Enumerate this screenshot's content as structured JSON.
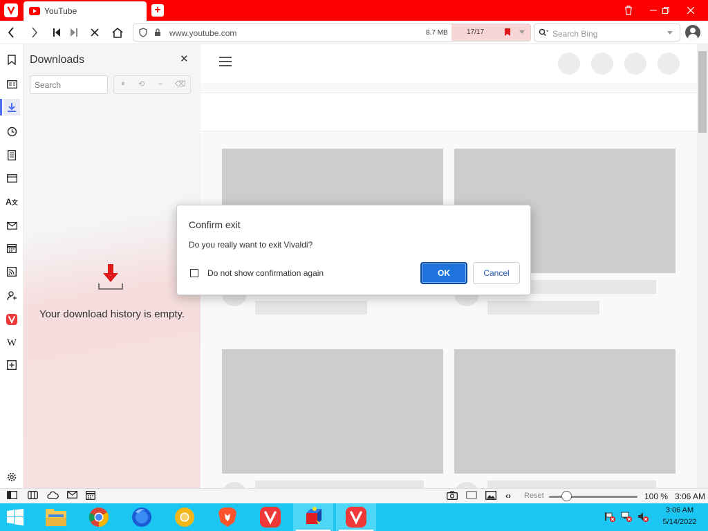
{
  "browser": {
    "tab": {
      "title": "YouTube"
    },
    "address": {
      "url": "www.youtube.com",
      "page_size": "8.7 MB",
      "blocker_count": "17/17"
    },
    "search": {
      "placeholder": "Search Bing"
    }
  },
  "downloads_panel": {
    "title": "Downloads",
    "search_placeholder": "Search",
    "empty_message": "Your download history is empty."
  },
  "dialog": {
    "title": "Confirm exit",
    "message": "Do you really want to exit Vivaldi?",
    "checkbox_label": "Do not show confirmation again",
    "checkbox_checked": false,
    "ok_label": "OK",
    "cancel_label": "Cancel"
  },
  "statusbar": {
    "reset_label": "Reset",
    "zoom": "100 %",
    "zoom_level": 0.2,
    "clock": "3:06 AM"
  },
  "taskbar": {
    "time": "3:06 AM",
    "date": "5/14/2022"
  },
  "colors": {
    "brand": "#fe0000",
    "taskbar": "#1bc7f2",
    "ok_button": "#1e73dd",
    "accent": "#4a6cf7"
  },
  "icons": {
    "side_panel": [
      "bookmark-icon",
      "reading-list-icon",
      "download-icon",
      "history-icon",
      "notes-icon",
      "window-icon",
      "translate-icon",
      "mail-icon",
      "calendar-icon",
      "feed-icon",
      "contacts-icon",
      "vivaldi-icon",
      "wikipedia-icon",
      "add-panel-icon",
      "settings-icon"
    ],
    "taskbar_apps": [
      "file-explorer-icon",
      "chrome-icon",
      "firefox-icon",
      "chrome-canary-icon",
      "brave-icon",
      "vivaldi-icon",
      "app-icon",
      "vivaldi-icon"
    ]
  }
}
